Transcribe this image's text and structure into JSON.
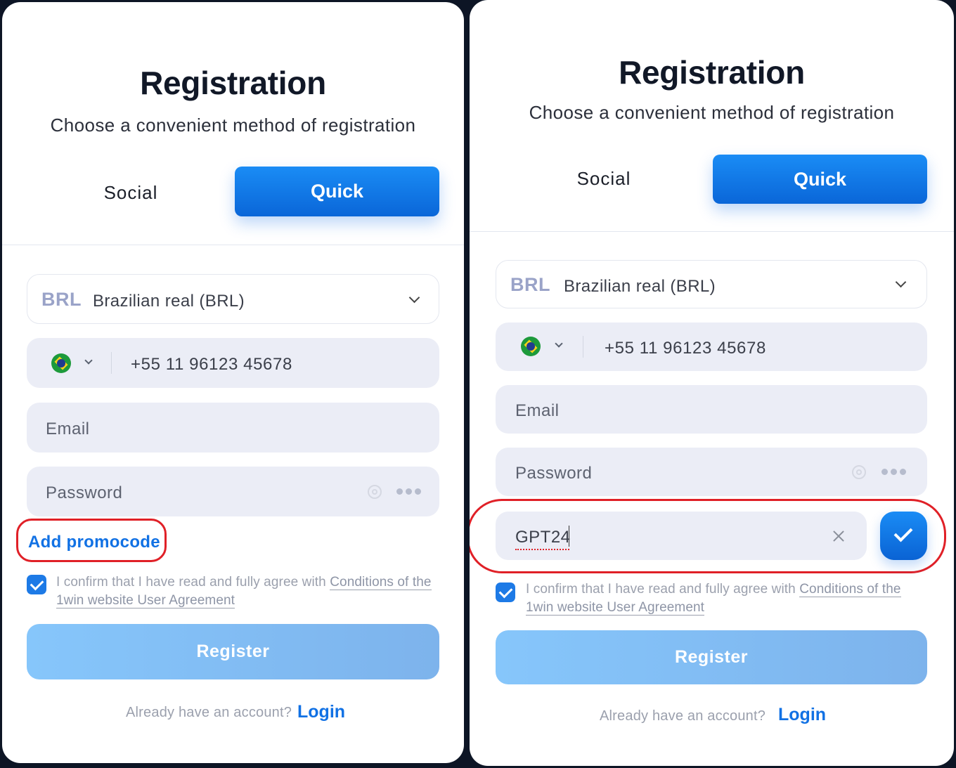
{
  "left": {
    "title": "Registration",
    "subtitle": "Choose a convenient method of registration",
    "tabs": {
      "social": "Social",
      "quick": "Quick"
    },
    "currency": {
      "code": "BRL",
      "name": "Brazilian real (BRL)"
    },
    "phone": {
      "country_icon": "brazil-flag-icon",
      "value": "+55 11 96123 45678"
    },
    "email": {
      "placeholder": "Email"
    },
    "password": {
      "placeholder": "Password"
    },
    "promo_link": "Add promocode",
    "agree": {
      "text": "I confirm that I have read and fully agree with ",
      "link": "Conditions of the 1win website User Agreement"
    },
    "register": "Register",
    "footer": {
      "question": "Already have an account?",
      "login": "Login"
    }
  },
  "right": {
    "title": "Registration",
    "subtitle": "Choose a convenient method of registration",
    "tabs": {
      "social": "Social",
      "quick": "Quick"
    },
    "currency": {
      "code": "BRL",
      "name": "Brazilian real (BRL)"
    },
    "phone": {
      "country_icon": "brazil-flag-icon",
      "value": "+55 11 96123 45678"
    },
    "email": {
      "placeholder": "Email"
    },
    "password": {
      "placeholder": "Password"
    },
    "promocode": {
      "value": "GPT24"
    },
    "agree": {
      "text": "I confirm that I have read and fully agree with ",
      "link": "Conditions of the 1win website User Agreement"
    },
    "register": "Register",
    "footer": {
      "question": "Already have an account?",
      "login": "Login"
    }
  },
  "colors": {
    "accent": "#1171e4",
    "highlight": "#e02027",
    "field_bg": "#ebedf6"
  }
}
